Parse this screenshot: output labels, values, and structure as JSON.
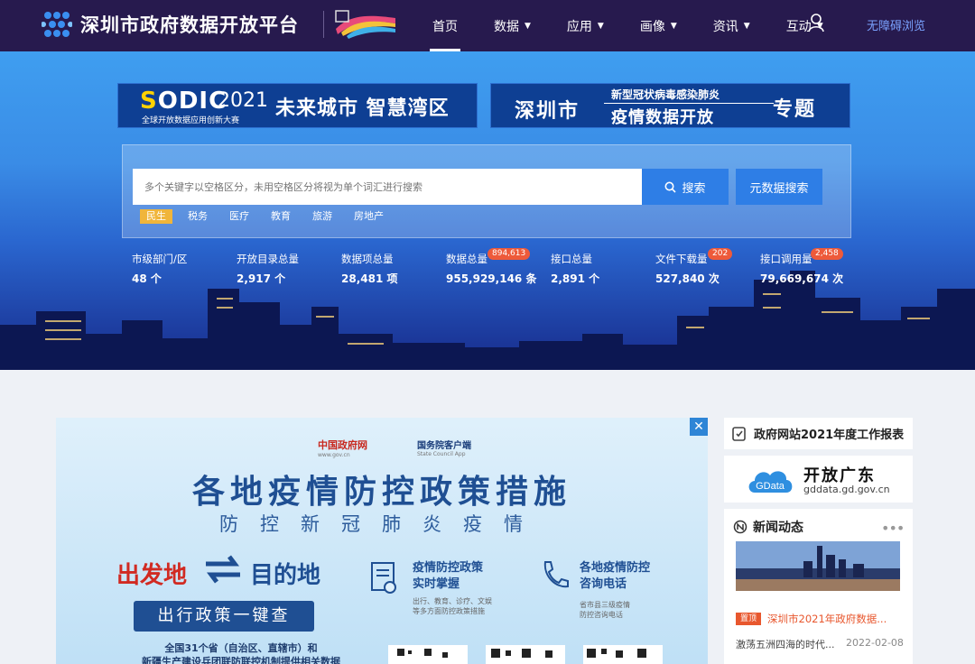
{
  "nav": {
    "site_title": "深圳市政府数据开放平台",
    "menu": [
      {
        "label": "首页",
        "active": true,
        "has_caret": false
      },
      {
        "label": "数据",
        "active": false,
        "has_caret": true
      },
      {
        "label": "应用",
        "active": false,
        "has_caret": true
      },
      {
        "label": "画像",
        "active": false,
        "has_caret": true
      },
      {
        "label": "资讯",
        "active": false,
        "has_caret": true
      },
      {
        "label": "互动",
        "active": false,
        "has_caret": true
      }
    ],
    "accessibility_label": "无障碍浏览",
    "user_icon": "user-icon"
  },
  "banners": {
    "sodic": {
      "sodic_a": "S",
      "sodic_b": "ODIC",
      "year": "2021",
      "subtitle": "全球开放数据应用创新大赛",
      "main": "未来城市 智慧湾区"
    },
    "covid": {
      "city": "深圳市",
      "line1": "新型冠状病毒感染肺炎",
      "line2": "疫情数据开放",
      "topic": "专题"
    }
  },
  "search": {
    "placeholder": "多个关键字以空格区分，未用空格区分将视为单个词汇进行搜索",
    "search_label": "搜索",
    "meta_label": "元数据搜索",
    "tags": [
      "民生",
      "税务",
      "医疗",
      "教育",
      "旅游",
      "房地产"
    ],
    "active_tag": "民生"
  },
  "stats": [
    {
      "label": "市级部门/区",
      "value": "48 个",
      "badge": ""
    },
    {
      "label": "开放目录总量",
      "value": "2,917 个",
      "badge": ""
    },
    {
      "label": "数据项总量",
      "value": "28,481 项",
      "badge": ""
    },
    {
      "label": "数据总量",
      "value": "955,929,146 条",
      "badge": "894,613"
    },
    {
      "label": "接口总量",
      "value": "2,891 个",
      "badge": ""
    },
    {
      "label": "文件下载量",
      "value": "527,840 次",
      "badge": "202"
    },
    {
      "label": "接口调用量",
      "value": "79,669,674 次",
      "badge": "2,458"
    }
  ],
  "ad": {
    "close": "✕",
    "org1": "中国政府网",
    "org1_en": "www.gov.cn",
    "org2": "国务院客户端",
    "org2_en": "State Council App",
    "title": "各地疫情防控政策措施",
    "subtitle": "防控新冠肺炎疫情",
    "from": "出发地",
    "to": "目的地",
    "pill": "出行政策一键查",
    "footer1": "全国31个省（自治区、直辖市）和",
    "footer2": "新疆生产建设兵团联防联控机制提供相关数据",
    "feature1_l1": "疫情防控政策",
    "feature1_l2": "实时掌握",
    "feature1_d1": "出行、教育、诊疗、文娱",
    "feature1_d2": "等多方面防控政策措施",
    "feature2_l1": "各地疫情防控",
    "feature2_l2": "咨询电话",
    "feature2_d1": "省市县三级疫情",
    "feature2_d2": "防控咨询电话"
  },
  "sidebar": {
    "report": "政府网站2021年度工作报表",
    "gdata_name": "GData",
    "gdata_title": "开放广东",
    "gdata_url": "gddata.gd.gov.cn",
    "news_title": "新闻动态",
    "news_more": "•••",
    "news_pin": "置顶",
    "news_headline": "深圳市2021年政府数据...",
    "news_item": "激荡五洲四海的时代...",
    "news_date": "2022-02-08"
  },
  "colors": {
    "nav_bg": "#271a4e",
    "accent": "#2e7ee6",
    "tag_active": "#f0b53b",
    "badge": "#ee5a3a",
    "news_orange": "#e8572e"
  }
}
